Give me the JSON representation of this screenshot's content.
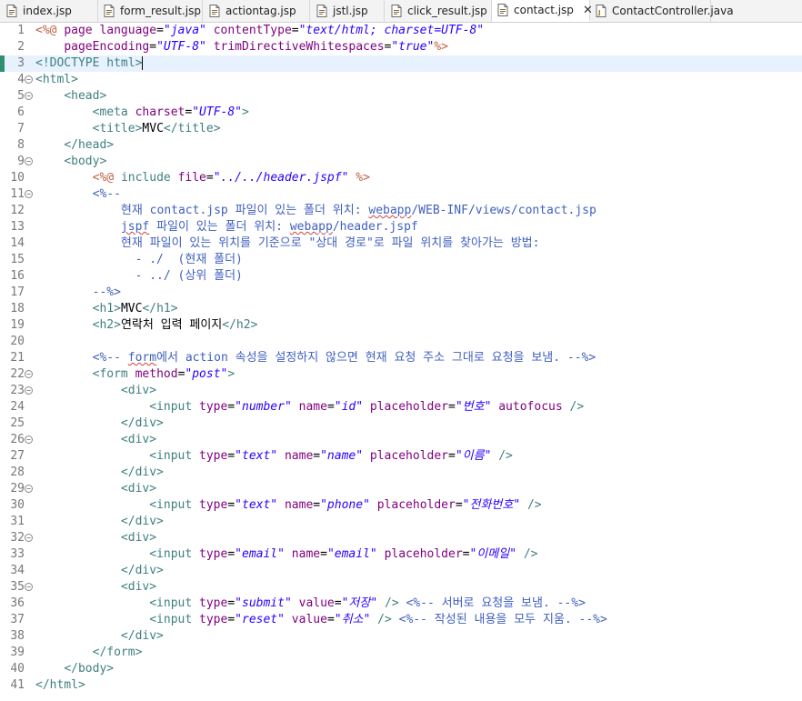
{
  "tabs": [
    {
      "label": "index.jsp",
      "icon": "jsp-file-icon"
    },
    {
      "label": "form_result.jsp",
      "icon": "jsp-file-icon"
    },
    {
      "label": "actiontag.jsp",
      "icon": "jsp-file-icon"
    },
    {
      "label": "jstl.jsp",
      "icon": "jsp-file-icon"
    },
    {
      "label": "click_result.jsp",
      "icon": "jsp-file-icon"
    },
    {
      "label": "contact.jsp",
      "icon": "jsp-file-icon",
      "active": true,
      "close": "✕"
    },
    {
      "label": "ContactController.java",
      "icon": "java-file-icon"
    }
  ],
  "colors": {
    "tag": "#3f7f7f",
    "attribute": "#7f007f",
    "string": "#2a00ff",
    "directive": "#bf5f3f",
    "comment": "#3f5fbf",
    "current_line": "#e8f2fe"
  },
  "lines": [
    {
      "n": "1",
      "fold": "",
      "segs": [
        [
          "dir",
          "<%@ "
        ],
        [
          "attr",
          "page language"
        ],
        [
          "txt",
          "="
        ],
        [
          "str",
          "\"java\""
        ],
        [
          "txt",
          " "
        ],
        [
          "attr",
          "contentType"
        ],
        [
          "txt",
          "="
        ],
        [
          "str",
          "\"text/html; charset=UTF-8\""
        ]
      ]
    },
    {
      "n": "2",
      "fold": "",
      "segs": [
        [
          "txt",
          "    "
        ],
        [
          "attr",
          "pageEncoding"
        ],
        [
          "txt",
          "="
        ],
        [
          "str",
          "\"UTF-8\""
        ],
        [
          "txt",
          " "
        ],
        [
          "attr",
          "trimDirectiveWhitespaces"
        ],
        [
          "txt",
          "="
        ],
        [
          "str",
          "\"true\""
        ],
        [
          "dir",
          "%>"
        ]
      ]
    },
    {
      "n": "3",
      "fold": "",
      "current": true,
      "segs": [
        [
          "tag",
          "<!DOCTYPE html>"
        ]
      ]
    },
    {
      "n": "4",
      "fold": "⊖",
      "segs": [
        [
          "tag",
          "<html>"
        ]
      ]
    },
    {
      "n": "5",
      "fold": "⊖",
      "segs": [
        [
          "txt",
          "    "
        ],
        [
          "tag",
          "<head>"
        ]
      ]
    },
    {
      "n": "6",
      "fold": "",
      "segs": [
        [
          "txt",
          "        "
        ],
        [
          "tag",
          "<meta "
        ],
        [
          "attr",
          "charset"
        ],
        [
          "txt",
          "="
        ],
        [
          "str",
          "\"UTF-8\""
        ],
        [
          "tag",
          ">"
        ]
      ]
    },
    {
      "n": "7",
      "fold": "",
      "segs": [
        [
          "txt",
          "        "
        ],
        [
          "tag",
          "<title>"
        ],
        [
          "txt",
          "MVC"
        ],
        [
          "tag",
          "</title>"
        ]
      ]
    },
    {
      "n": "8",
      "fold": "",
      "segs": [
        [
          "txt",
          "    "
        ],
        [
          "tag",
          "</head>"
        ]
      ]
    },
    {
      "n": "9",
      "fold": "⊖",
      "segs": [
        [
          "txt",
          "    "
        ],
        [
          "tag",
          "<body>"
        ]
      ]
    },
    {
      "n": "10",
      "fold": "",
      "segs": [
        [
          "txt",
          "        "
        ],
        [
          "dir",
          "<%@ "
        ],
        [
          "tag",
          "include "
        ],
        [
          "attr",
          "file"
        ],
        [
          "txt",
          "="
        ],
        [
          "str",
          "\"../../header.jspf\""
        ],
        [
          "dir",
          " %>"
        ]
      ]
    },
    {
      "n": "11",
      "fold": "⊖",
      "segs": [
        [
          "txt",
          "        "
        ],
        [
          "cm",
          "<%--"
        ]
      ]
    },
    {
      "n": "12",
      "fold": "",
      "segs": [
        [
          "cm",
          "            현재 contact.jsp 파일이 있는 폴더 위치: "
        ],
        [
          "cm sq",
          "webapp"
        ],
        [
          "cm",
          "/WEB-INF/views/contact.jsp"
        ]
      ]
    },
    {
      "n": "13",
      "fold": "",
      "segs": [
        [
          "cm",
          "            "
        ],
        [
          "cm sq",
          "jspf"
        ],
        [
          "cm",
          " 파일이 있는 폴더 위치: "
        ],
        [
          "cm sq",
          "webapp"
        ],
        [
          "cm",
          "/header.jspf"
        ]
      ]
    },
    {
      "n": "14",
      "fold": "",
      "segs": [
        [
          "cm",
          "            현재 파일이 있는 위치를 기준으로 \"상대 경로\"로 파일 위치를 찾아가는 방법:"
        ]
      ]
    },
    {
      "n": "15",
      "fold": "",
      "segs": [
        [
          "cm",
          "              - ./  (현재 폴더)"
        ]
      ]
    },
    {
      "n": "16",
      "fold": "",
      "segs": [
        [
          "cm",
          "              - ../ (상위 폴더)"
        ]
      ]
    },
    {
      "n": "17",
      "fold": "",
      "segs": [
        [
          "txt",
          "        "
        ],
        [
          "cm",
          "--%>"
        ]
      ]
    },
    {
      "n": "18",
      "fold": "",
      "segs": [
        [
          "txt",
          "        "
        ],
        [
          "tag",
          "<h1>"
        ],
        [
          "txt",
          "MVC"
        ],
        [
          "tag",
          "</h1>"
        ]
      ]
    },
    {
      "n": "19",
      "fold": "",
      "segs": [
        [
          "txt",
          "        "
        ],
        [
          "tag",
          "<h2>"
        ],
        [
          "txt",
          "연락처 입력 페이지"
        ],
        [
          "tag",
          "</h2>"
        ]
      ]
    },
    {
      "n": "20",
      "fold": "",
      "segs": []
    },
    {
      "n": "21",
      "fold": "",
      "segs": [
        [
          "txt",
          "        "
        ],
        [
          "cm",
          "<%-- "
        ],
        [
          "cm sq",
          "form"
        ],
        [
          "cm",
          "에서 action 속성을 설정하지 않으면 현재 요청 주소 그대로 요청을 보냄. --%>"
        ]
      ]
    },
    {
      "n": "22",
      "fold": "⊖",
      "segs": [
        [
          "txt",
          "        "
        ],
        [
          "tag",
          "<form "
        ],
        [
          "attr",
          "method"
        ],
        [
          "txt",
          "="
        ],
        [
          "str",
          "\"post\""
        ],
        [
          "tag",
          ">"
        ]
      ]
    },
    {
      "n": "23",
      "fold": "⊖",
      "segs": [
        [
          "txt",
          "            "
        ],
        [
          "tag",
          "<div>"
        ]
      ]
    },
    {
      "n": "24",
      "fold": "",
      "segs": [
        [
          "txt",
          "                "
        ],
        [
          "tag",
          "<input "
        ],
        [
          "attr",
          "type"
        ],
        [
          "txt",
          "="
        ],
        [
          "str",
          "\"number\""
        ],
        [
          "txt",
          " "
        ],
        [
          "attr",
          "name"
        ],
        [
          "txt",
          "="
        ],
        [
          "str",
          "\"id\""
        ],
        [
          "txt",
          " "
        ],
        [
          "attr",
          "placeholder"
        ],
        [
          "txt",
          "="
        ],
        [
          "str",
          "\"번호\""
        ],
        [
          "txt",
          " "
        ],
        [
          "attr",
          "autofocus"
        ],
        [
          "txt",
          " "
        ],
        [
          "tag",
          "/>"
        ]
      ]
    },
    {
      "n": "25",
      "fold": "",
      "segs": [
        [
          "txt",
          "            "
        ],
        [
          "tag",
          "</div>"
        ]
      ]
    },
    {
      "n": "26",
      "fold": "⊖",
      "segs": [
        [
          "txt",
          "            "
        ],
        [
          "tag",
          "<div>"
        ]
      ]
    },
    {
      "n": "27",
      "fold": "",
      "segs": [
        [
          "txt",
          "                "
        ],
        [
          "tag",
          "<input "
        ],
        [
          "attr",
          "type"
        ],
        [
          "txt",
          "="
        ],
        [
          "str",
          "\"text\""
        ],
        [
          "txt",
          " "
        ],
        [
          "attr",
          "name"
        ],
        [
          "txt",
          "="
        ],
        [
          "str",
          "\"name\""
        ],
        [
          "txt",
          " "
        ],
        [
          "attr",
          "placeholder"
        ],
        [
          "txt",
          "="
        ],
        [
          "str",
          "\"이름\""
        ],
        [
          "txt",
          " "
        ],
        [
          "tag",
          "/>"
        ]
      ]
    },
    {
      "n": "28",
      "fold": "",
      "segs": [
        [
          "txt",
          "            "
        ],
        [
          "tag",
          "</div>"
        ]
      ]
    },
    {
      "n": "29",
      "fold": "⊖",
      "segs": [
        [
          "txt",
          "            "
        ],
        [
          "tag",
          "<div>"
        ]
      ]
    },
    {
      "n": "30",
      "fold": "",
      "segs": [
        [
          "txt",
          "                "
        ],
        [
          "tag",
          "<input "
        ],
        [
          "attr",
          "type"
        ],
        [
          "txt",
          "="
        ],
        [
          "str",
          "\"text\""
        ],
        [
          "txt",
          " "
        ],
        [
          "attr",
          "name"
        ],
        [
          "txt",
          "="
        ],
        [
          "str",
          "\"phone\""
        ],
        [
          "txt",
          " "
        ],
        [
          "attr",
          "placeholder"
        ],
        [
          "txt",
          "="
        ],
        [
          "str",
          "\"전화번호\""
        ],
        [
          "txt",
          " "
        ],
        [
          "tag",
          "/>"
        ]
      ]
    },
    {
      "n": "31",
      "fold": "",
      "segs": [
        [
          "txt",
          "            "
        ],
        [
          "tag",
          "</div>"
        ]
      ]
    },
    {
      "n": "32",
      "fold": "⊖",
      "segs": [
        [
          "txt",
          "            "
        ],
        [
          "tag",
          "<div>"
        ]
      ]
    },
    {
      "n": "33",
      "fold": "",
      "segs": [
        [
          "txt",
          "                "
        ],
        [
          "tag",
          "<input "
        ],
        [
          "attr",
          "type"
        ],
        [
          "txt",
          "="
        ],
        [
          "str",
          "\"email\""
        ],
        [
          "txt",
          " "
        ],
        [
          "attr",
          "name"
        ],
        [
          "txt",
          "="
        ],
        [
          "str",
          "\"email\""
        ],
        [
          "txt",
          " "
        ],
        [
          "attr",
          "placeholder"
        ],
        [
          "txt",
          "="
        ],
        [
          "str",
          "\"이메일\""
        ],
        [
          "txt",
          " "
        ],
        [
          "tag",
          "/>"
        ]
      ]
    },
    {
      "n": "34",
      "fold": "",
      "segs": [
        [
          "txt",
          "            "
        ],
        [
          "tag",
          "</div>"
        ]
      ]
    },
    {
      "n": "35",
      "fold": "⊖",
      "segs": [
        [
          "txt",
          "            "
        ],
        [
          "tag",
          "<div>"
        ]
      ]
    },
    {
      "n": "36",
      "fold": "",
      "segs": [
        [
          "txt",
          "                "
        ],
        [
          "tag",
          "<input "
        ],
        [
          "attr",
          "type"
        ],
        [
          "txt",
          "="
        ],
        [
          "str",
          "\"submit\""
        ],
        [
          "txt",
          " "
        ],
        [
          "attr",
          "value"
        ],
        [
          "txt",
          "="
        ],
        [
          "str",
          "\"저장\""
        ],
        [
          "txt",
          " "
        ],
        [
          "tag",
          "/>"
        ],
        [
          "txt",
          " "
        ],
        [
          "cm",
          "<%-- 서버로 요청을 보냄. --%>"
        ]
      ]
    },
    {
      "n": "37",
      "fold": "",
      "segs": [
        [
          "txt",
          "                "
        ],
        [
          "tag",
          "<input "
        ],
        [
          "attr",
          "type"
        ],
        [
          "txt",
          "="
        ],
        [
          "str",
          "\"reset\""
        ],
        [
          "txt",
          " "
        ],
        [
          "attr",
          "value"
        ],
        [
          "txt",
          "="
        ],
        [
          "str",
          "\"취소\""
        ],
        [
          "txt",
          " "
        ],
        [
          "tag",
          "/>"
        ],
        [
          "txt",
          " "
        ],
        [
          "cm",
          "<%-- 작성된 내용을 모두 지움. --%>"
        ]
      ]
    },
    {
      "n": "38",
      "fold": "",
      "segs": [
        [
          "txt",
          "            "
        ],
        [
          "tag",
          "</div>"
        ]
      ]
    },
    {
      "n": "39",
      "fold": "",
      "segs": [
        [
          "txt",
          "        "
        ],
        [
          "tag",
          "</form>"
        ]
      ]
    },
    {
      "n": "40",
      "fold": "",
      "segs": [
        [
          "txt",
          "    "
        ],
        [
          "tag",
          "</body>"
        ]
      ]
    },
    {
      "n": "41",
      "fold": "",
      "segs": [
        [
          "tag",
          "</html>"
        ]
      ]
    }
  ]
}
